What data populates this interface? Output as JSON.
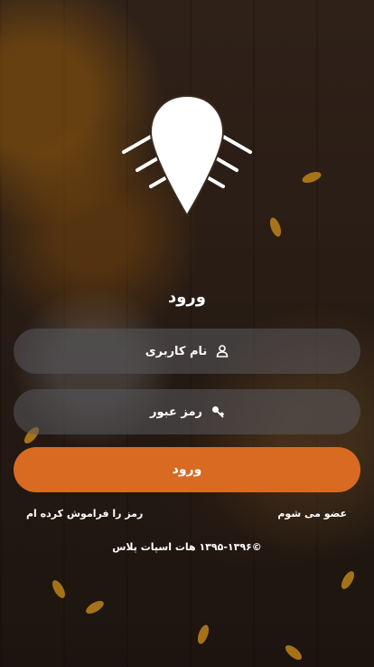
{
  "login": {
    "title": "ورود",
    "username_placeholder": "نام کاربری",
    "password_placeholder": "رمز عبور",
    "submit_label": "ورود",
    "forgot_password": "رمز را فراموش کرده ام",
    "register": "عضو می شوم",
    "footer": "©۱۳۹۵-۱۳۹۶ هات اسپات پلاس"
  },
  "icons": {
    "logo": "location-pin-wifi-icon",
    "username": "user-icon",
    "password": "key-icon"
  },
  "colors": {
    "accent": "#d86a22",
    "text": "#ffffff",
    "field_bg": "rgba(90,90,95,0.55)"
  }
}
